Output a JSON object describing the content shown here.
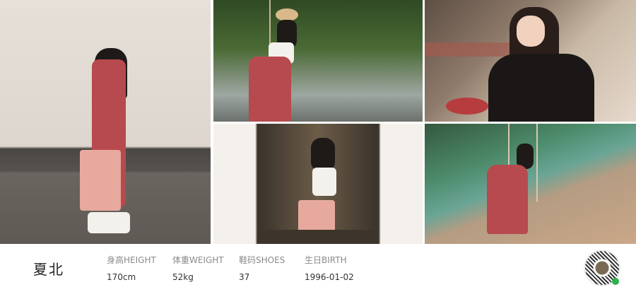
{
  "profile": {
    "name": "夏北",
    "stats": [
      {
        "label": "身高HEIGHT",
        "value": "170cm"
      },
      {
        "label": "体重WEIGHT",
        "value": "52kg"
      },
      {
        "label": "鞋码SHOES",
        "value": "37"
      },
      {
        "label": "生日BIRTH",
        "value": "1996-01-02"
      }
    ]
  },
  "colors": {
    "dress": "#b64a4e",
    "tote": "#e7a99e",
    "accent": "#2bb24c"
  },
  "icons": {
    "qr": "wechat-qr-code-icon"
  }
}
